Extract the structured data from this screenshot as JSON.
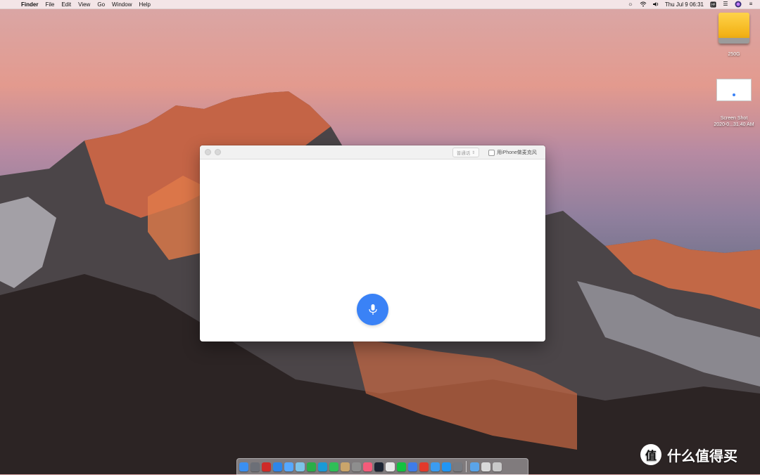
{
  "menubar": {
    "apple": "",
    "app_name": "Finder",
    "menus": [
      "File",
      "Edit",
      "View",
      "Go",
      "Window",
      "Help"
    ],
    "status_icons": [
      "brightness-icon",
      "wifi-icon",
      "volume-icon"
    ],
    "clock": "Thu Jul 9  06:31",
    "extra_icons": [
      "input-method-icon",
      "list-icon",
      "siri-icon",
      "menu-icon"
    ]
  },
  "desktop": {
    "drive_label": "250G",
    "screenshot_label_line1": "Screen Shot",
    "screenshot_label_line2": "2020-0...31.40 AM"
  },
  "dictation_window": {
    "language_select": "普通话",
    "iphone_mic_label": "用iPhone做麦克风",
    "mic_icon": "microphone-icon",
    "accent": "#3a82f6"
  },
  "dock": {
    "apps": [
      {
        "name": "finder",
        "color": "#3b8ff0"
      },
      {
        "name": "launchpad",
        "color": "#6c6f77"
      },
      {
        "name": "acrobat",
        "color": "#cf2a27"
      },
      {
        "name": "safari",
        "color": "#2e86e8"
      },
      {
        "name": "mail",
        "color": "#56a8ff"
      },
      {
        "name": "preview",
        "color": "#7cc3e8"
      },
      {
        "name": "wechat",
        "color": "#2aae47"
      },
      {
        "name": "qq",
        "color": "#1a9ad6"
      },
      {
        "name": "messages",
        "color": "#2fbf57"
      },
      {
        "name": "notes",
        "color": "#caa56b"
      },
      {
        "name": "photos",
        "color": "#8e8e8e"
      },
      {
        "name": "music",
        "color": "#f35b7a"
      },
      {
        "name": "media",
        "color": "#1c2432"
      },
      {
        "name": "store",
        "color": "#e8e8e8"
      },
      {
        "name": "iqiyi",
        "color": "#13c23f"
      },
      {
        "name": "tencent-video",
        "color": "#3f7ce8"
      },
      {
        "name": "weibo",
        "color": "#e23a2b"
      },
      {
        "name": "maps",
        "color": "#3b9cf0"
      },
      {
        "name": "app-store",
        "color": "#2196f3"
      },
      {
        "name": "system-preferences",
        "color": "#777b82"
      }
    ],
    "right_items": [
      {
        "name": "folder",
        "color": "#5aa4e8"
      },
      {
        "name": "downloads",
        "color": "#d9d9d9"
      },
      {
        "name": "trash",
        "color": "#c9c9c9"
      }
    ]
  },
  "watermark": {
    "badge": "值",
    "text": "什么值得买"
  }
}
